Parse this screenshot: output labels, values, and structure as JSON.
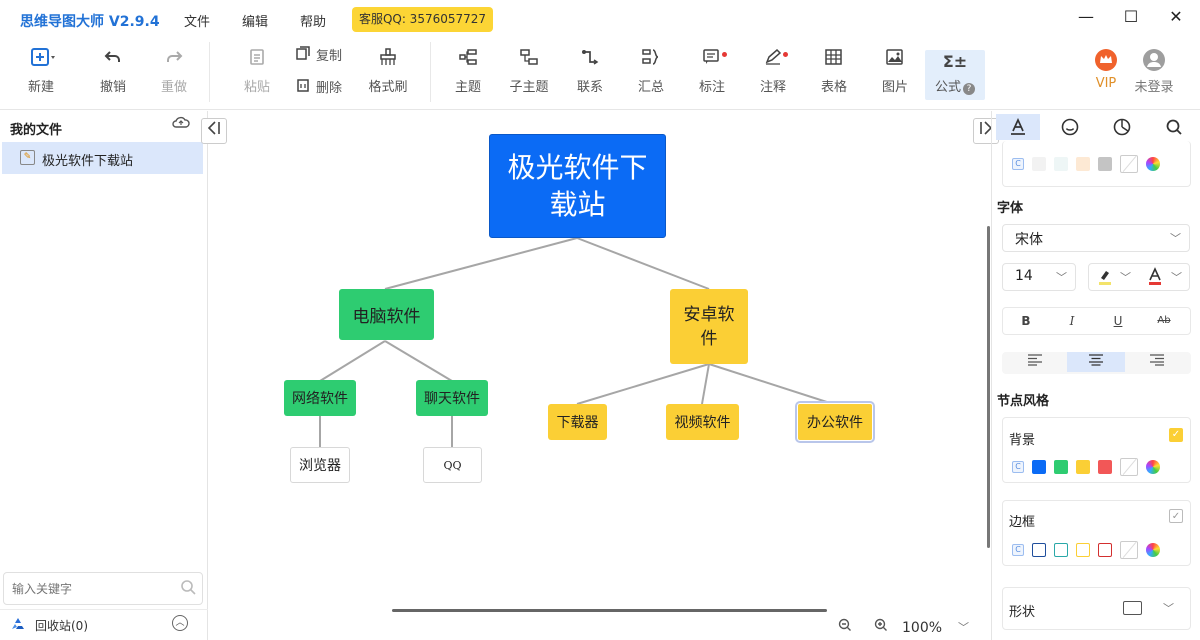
{
  "titlebar": {
    "app_title": "思维导图大师 V2.9.4",
    "menu": [
      "文件",
      "编辑",
      "帮助"
    ],
    "service": "客服QQ: 3576057727",
    "minimize": "—",
    "maximize": "☐",
    "close": "✕"
  },
  "toolbar": {
    "new": "新建",
    "undo": "撤销",
    "redo": "重做",
    "paste": "粘贴",
    "copy": "复制",
    "delete": "删除",
    "format_painter": "格式刷",
    "topic": "主题",
    "subtopic": "子主题",
    "relation": "联系",
    "summary": "汇总",
    "marker": "标注",
    "note": "注释",
    "table": "表格",
    "image": "图片",
    "formula": "公式",
    "vip": "VIP",
    "login": "未登录"
  },
  "left_panel": {
    "title": "我的文件",
    "files": [
      "极光软件下载站"
    ],
    "search_placeholder": "输入关键字",
    "recycle_bin": "回收站(0)"
  },
  "mindmap": {
    "root": "极光软件下载站",
    "branch_pc": "电脑软件",
    "branch_android": "安卓软件",
    "pc_network": "网络软件",
    "pc_chat": "聊天软件",
    "browser": "浏览器",
    "qq": "QQ",
    "downloader": "下载器",
    "video": "视频软件",
    "office": "办公软件",
    "colors": {
      "root": "#0b6bf5",
      "branch_pc": "#2ecc71",
      "branch_android": "#fbcf35",
      "line": "#a6a6a6"
    }
  },
  "statusbar": {
    "zoom": "100%"
  },
  "right_panel": {
    "font_section": "字体",
    "font_family": "宋体",
    "font_size": "14",
    "node_style_section": "节点风格",
    "background": "背景",
    "border": "边框",
    "shape": "形状",
    "bold": "B",
    "italic": "I",
    "underline": "U",
    "strike": "Ab",
    "bg_colors": [
      "#0b6bf5",
      "#2ecc71",
      "#fbcf35",
      "#f25757"
    ],
    "border_colors": [
      "#1f4e9c",
      "#2aa8a8",
      "#fbcf35",
      "#d32f2f"
    ],
    "top_swatches": [
      "#f2f2f2",
      "#eef6f6",
      "#fde9d4",
      "#c4c4c4"
    ]
  }
}
